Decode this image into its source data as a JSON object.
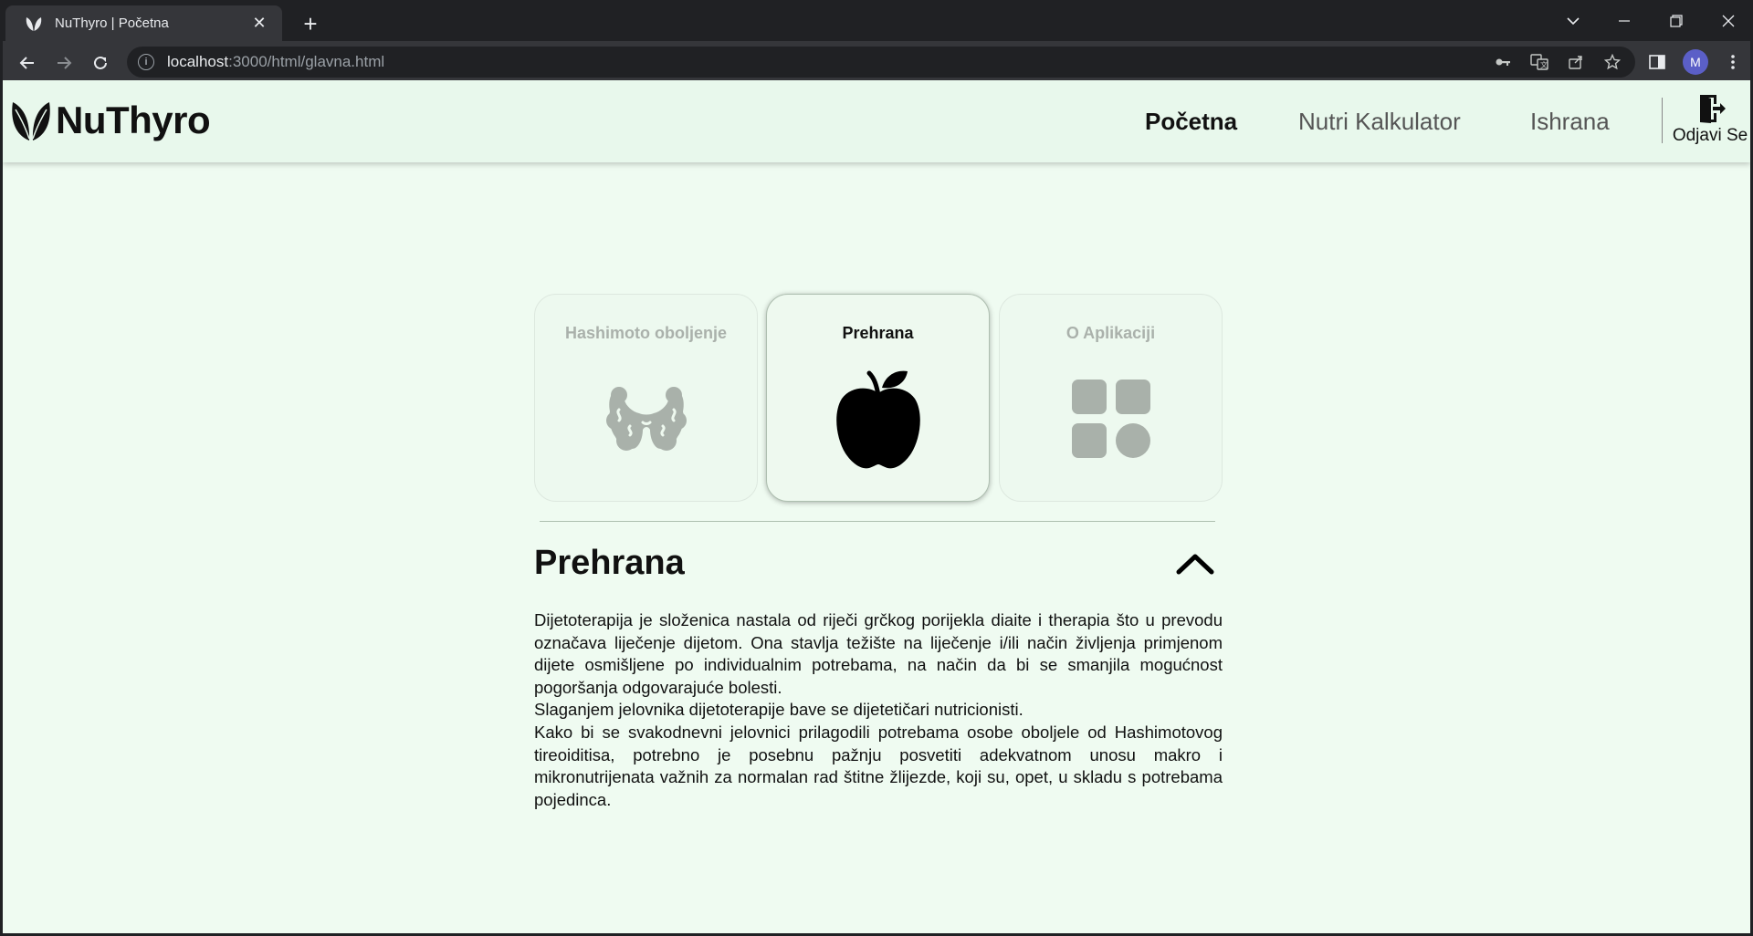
{
  "browser": {
    "tab_title": "NuThyro | Početna",
    "tab_close": "✕",
    "new_tab": "+",
    "url_host": "localhost",
    "url_path": ":3000/html/glavna.html",
    "avatar_initial": "M"
  },
  "navbar": {
    "logo_text": "NuThyro",
    "links": [
      {
        "label": "Početna",
        "active": true
      },
      {
        "label": "Nutri Kalkulator",
        "active": false
      },
      {
        "label": "Ishrana",
        "active": false
      }
    ],
    "logout_label": "Odjavi Se"
  },
  "cards": [
    {
      "label": "Hashimoto oboljenje",
      "icon": "thyroid-icon",
      "active": false
    },
    {
      "label": "Prehrana",
      "icon": "apple-icon",
      "active": true
    },
    {
      "label": "O Aplikaciji",
      "icon": "apps-grid-icon",
      "active": false
    }
  ],
  "section": {
    "title": "Prehrana",
    "paragraphs": [
      "Dijetoterapija je složenica nastala od riječi grčkog porijekla diaite i therapia što u prevodu označava liječenje dijetom. Ona stavlja težište na liječenje i/ili način življenja primjenom dijete osmišljene po individualnim potrebama, na način da bi se smanjila mogućnost pogoršanja odgovarajuće bolesti.",
      "Slaganjem jelovnika dijetoterapije bave se dijetetičari nutricionisti.",
      "Kako bi se svakodnevni jelovnici prilagodili potrebama osobe oboljele od Hashimotovog tireoiditisa, potrebno je posebnu pažnju posvetiti adekvatnom unosu makro i mikronutrijenata važnih za normalan rad štitne žlijezde, koji su, opet, u skladu s potrebama pojedinca."
    ]
  },
  "colors": {
    "page_bg": "#effbf1",
    "navbar_bg": "#e8f8ec",
    "inactive_icon": "#a9b1aa",
    "active_icon": "#000000"
  }
}
